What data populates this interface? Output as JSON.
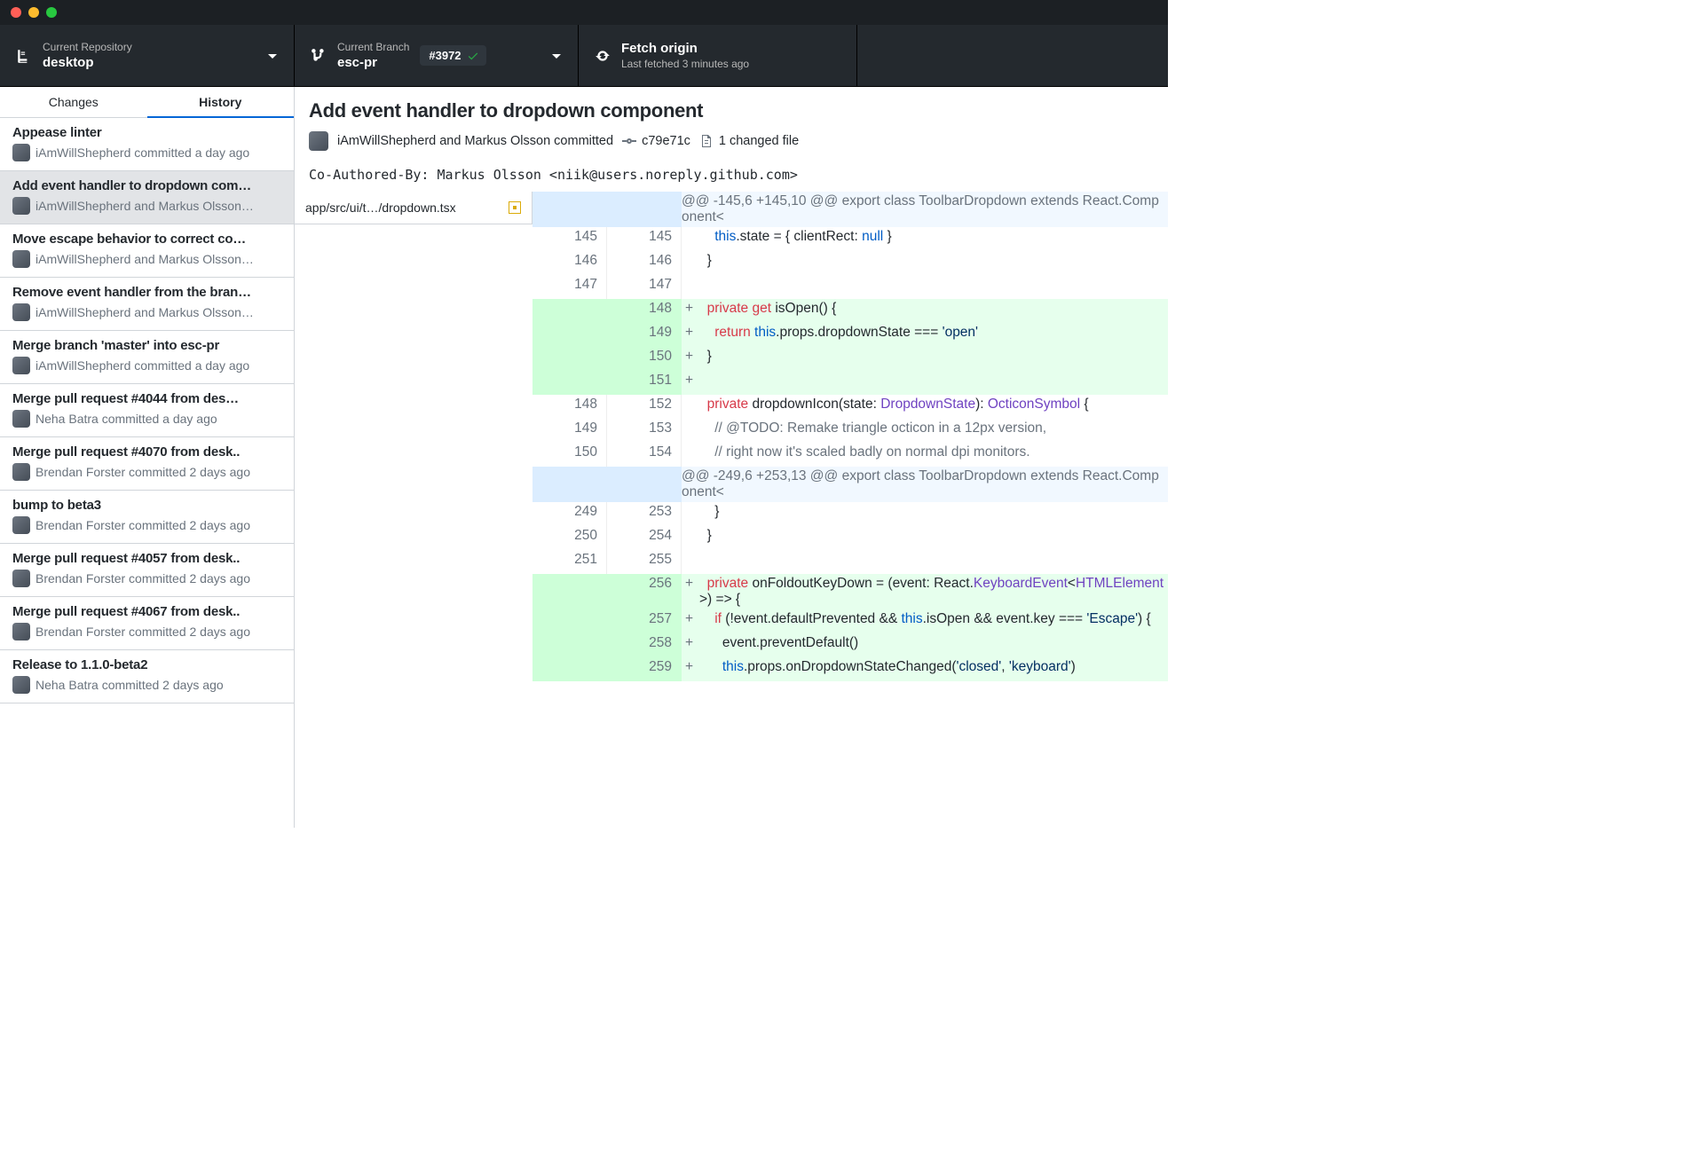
{
  "toolbar": {
    "repo": {
      "label": "Current Repository",
      "value": "desktop"
    },
    "branch": {
      "label": "Current Branch",
      "value": "esc-pr",
      "pr": "#3972"
    },
    "fetch": {
      "label": "Fetch origin",
      "sub": "Last fetched 3 minutes ago"
    }
  },
  "tabs": {
    "changes": "Changes",
    "history": "History"
  },
  "commits": [
    {
      "title": "Appease linter",
      "meta": "iAmWillShepherd committed a day ago"
    },
    {
      "title": "Add event handler to dropdown com…",
      "meta": "iAmWillShepherd and Markus Olsson…",
      "selected": true
    },
    {
      "title": "Move escape behavior to correct co…",
      "meta": "iAmWillShepherd and Markus Olsson…"
    },
    {
      "title": "Remove event handler from the bran…",
      "meta": "iAmWillShepherd and Markus Olsson…"
    },
    {
      "title": "Merge branch 'master' into esc-pr",
      "meta": "iAmWillShepherd committed a day ago"
    },
    {
      "title": "Merge pull request #4044 from des…",
      "meta": "Neha Batra committed a day ago"
    },
    {
      "title": "Merge pull request #4070 from desk..",
      "meta": "Brendan Forster committed 2 days ago"
    },
    {
      "title": "bump to beta3",
      "meta": "Brendan Forster committed 2 days ago"
    },
    {
      "title": "Merge pull request #4057 from desk..",
      "meta": "Brendan Forster committed 2 days ago"
    },
    {
      "title": "Merge pull request #4067 from desk..",
      "meta": "Brendan Forster committed 2 days ago"
    },
    {
      "title": "Release to 1.1.0-beta2",
      "meta": "Neha Batra committed 2 days ago"
    }
  ],
  "detail": {
    "title": "Add event handler to dropdown component",
    "authors": "iAmWillShepherd and Markus Olsson committed",
    "sha": "c79e71c",
    "files_label": "1 changed file",
    "co_authored": "Co-Authored-By: Markus Olsson <niik@users.noreply.github.com>",
    "file_tab": "app/src/ui/t…/dropdown.tsx"
  },
  "diff": [
    {
      "type": "hunk",
      "code": "@@ -145,6 +145,10 @@ export class ToolbarDropdown extends React.Component<"
    },
    {
      "type": "ctx",
      "l": "145",
      "r": "145",
      "code": "    <span class='kw-this'>this</span>.state = { clientRect: <span class='kw-null'>null</span> }"
    },
    {
      "type": "ctx",
      "l": "146",
      "r": "146",
      "code": "  }"
    },
    {
      "type": "ctx",
      "l": "147",
      "r": "147",
      "code": ""
    },
    {
      "type": "add",
      "r": "148",
      "m": "+",
      "code": "  <span class='kw-key'>private</span> <span class='kw-key'>get</span> isOpen() {"
    },
    {
      "type": "add",
      "r": "149",
      "m": "+",
      "code": "    <span class='kw-key'>return</span> <span class='kw-this'>this</span>.props.dropdownState === <span class='kw-str'>'open'</span>"
    },
    {
      "type": "add",
      "r": "150",
      "m": "+",
      "code": "  }"
    },
    {
      "type": "add",
      "r": "151",
      "m": "+",
      "code": ""
    },
    {
      "type": "ctx",
      "l": "148",
      "r": "152",
      "code": "  <span class='kw-key'>private</span> dropdownIcon(state: <span class='kw-type'>DropdownState</span>): <span class='kw-type'>OcticonSymbol</span> {"
    },
    {
      "type": "ctx",
      "l": "149",
      "r": "153",
      "code": "    <span class='kw-comment'>// @TODO: Remake triangle octicon in a 12px version,</span>"
    },
    {
      "type": "ctx",
      "l": "150",
      "r": "154",
      "code": "    <span class='kw-comment'>// right now it's scaled badly on normal dpi monitors.</span>"
    },
    {
      "type": "hunk",
      "code": "@@ -249,6 +253,13 @@ export class ToolbarDropdown extends React.Component<"
    },
    {
      "type": "ctx",
      "l": "249",
      "r": "253",
      "code": "    }"
    },
    {
      "type": "ctx",
      "l": "250",
      "r": "254",
      "code": "  }"
    },
    {
      "type": "ctx",
      "l": "251",
      "r": "255",
      "code": ""
    },
    {
      "type": "add",
      "r": "256",
      "m": "+",
      "code": "  <span class='kw-key'>private</span> onFoldoutKeyDown = (event: React.<span class='kw-type'>KeyboardEvent</span>&lt;<span class='kw-type'>HTMLElement</span>&gt;) =&gt; {"
    },
    {
      "type": "add",
      "r": "257",
      "m": "+",
      "code": "    <span class='kw-key'>if</span> (!event.defaultPrevented &amp;&amp; <span class='kw-this'>this</span>.isOpen &amp;&amp; event.key === <span class='kw-str'>'Escape'</span>) {"
    },
    {
      "type": "add",
      "r": "258",
      "m": "+",
      "code": "      event.preventDefault()"
    },
    {
      "type": "add",
      "r": "259",
      "m": "+",
      "code": "      <span class='kw-this'>this</span>.props.onDropdownStateChanged(<span class='kw-str'>'closed'</span>, <span class='kw-str'>'keyboard'</span>)"
    }
  ]
}
